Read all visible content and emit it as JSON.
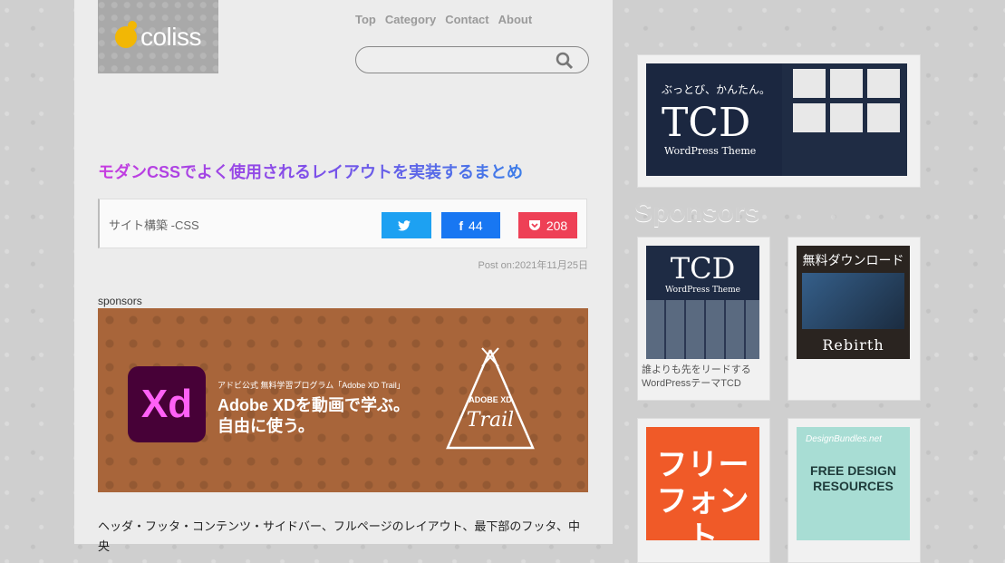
{
  "logo": {
    "text": "coliss"
  },
  "nav": {
    "items": [
      "Top",
      "Category",
      "Contact",
      "About"
    ]
  },
  "search": {
    "placeholder": ""
  },
  "article": {
    "title": "モダンCSSでよく使用されるレイアウトを実装するまとめ",
    "category": "サイト構築 -CSS",
    "share_twitter": "",
    "share_facebook": "44",
    "share_pocket": "208",
    "post_on": "Post on:2021年11月25日",
    "body": "ヘッダ・フッタ・コンテンツ・サイドバー、フルページのレイアウト、最下部のフッタ、中央"
  },
  "sponsor_label": "sponsors",
  "ad": {
    "logo_text": "Xd",
    "small": "アドビ公式 無料学習プログラム「Adobe XD Trail」",
    "headline1": "Adobe XDを動画で学ぶ。",
    "headline2": "自由に使う。",
    "trail_title": "ADOBE XD",
    "trail_word": "Trail"
  },
  "sidebar": {
    "tcd_banner": {
      "tagline": "ぶっとび、かんたん。",
      "word": "TCD",
      "sub": "WordPress Theme"
    },
    "sponsors_heading": "Sponsors",
    "ad1": {
      "word": "TCD",
      "sub": "WordPress Theme",
      "caption": "誰よりも先をリードするWordPressテーマTCD"
    },
    "ad2": {
      "heading": "無料ダウンロード",
      "footer": "Rebirth"
    },
    "ad3": {
      "text": "フリーフォント"
    },
    "ad4": {
      "brand": "DesignBundles.net",
      "text": "FREE DESIGN RESOURCES"
    }
  },
  "colors": {
    "twitter": "#1da1f2",
    "facebook": "#1877f2",
    "pocket": "#ee4056",
    "ad_bg": "#a8653a"
  }
}
